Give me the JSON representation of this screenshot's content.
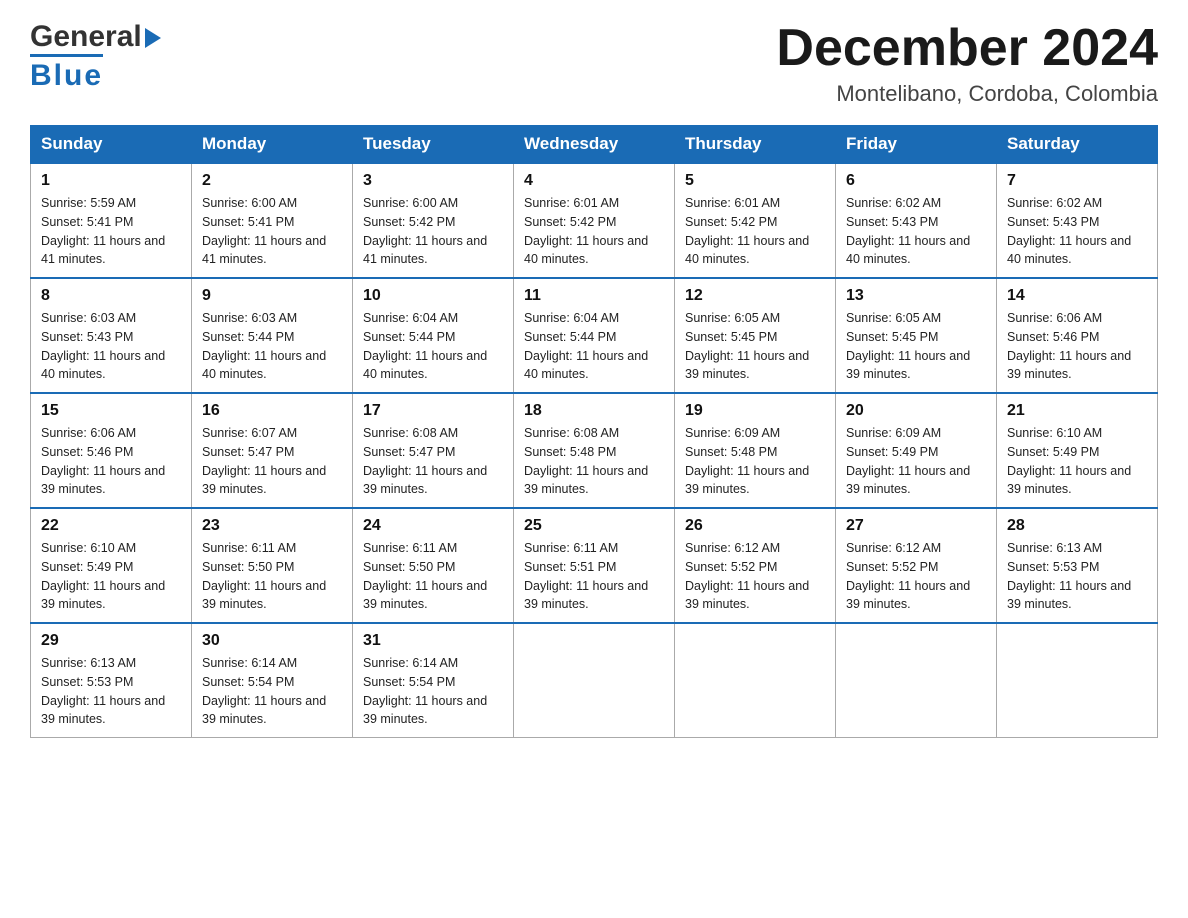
{
  "header": {
    "logo_line1": "General",
    "logo_arrow": "▶",
    "logo_line2": "Blue",
    "month_title": "December 2024",
    "location": "Montelibano, Cordoba, Colombia"
  },
  "days_of_week": [
    "Sunday",
    "Monday",
    "Tuesday",
    "Wednesday",
    "Thursday",
    "Friday",
    "Saturday"
  ],
  "weeks": [
    [
      {
        "day": "1",
        "sunrise": "5:59 AM",
        "sunset": "5:41 PM",
        "daylight": "11 hours and 41 minutes."
      },
      {
        "day": "2",
        "sunrise": "6:00 AM",
        "sunset": "5:41 PM",
        "daylight": "11 hours and 41 minutes."
      },
      {
        "day": "3",
        "sunrise": "6:00 AM",
        "sunset": "5:42 PM",
        "daylight": "11 hours and 41 minutes."
      },
      {
        "day": "4",
        "sunrise": "6:01 AM",
        "sunset": "5:42 PM",
        "daylight": "11 hours and 40 minutes."
      },
      {
        "day": "5",
        "sunrise": "6:01 AM",
        "sunset": "5:42 PM",
        "daylight": "11 hours and 40 minutes."
      },
      {
        "day": "6",
        "sunrise": "6:02 AM",
        "sunset": "5:43 PM",
        "daylight": "11 hours and 40 minutes."
      },
      {
        "day": "7",
        "sunrise": "6:02 AM",
        "sunset": "5:43 PM",
        "daylight": "11 hours and 40 minutes."
      }
    ],
    [
      {
        "day": "8",
        "sunrise": "6:03 AM",
        "sunset": "5:43 PM",
        "daylight": "11 hours and 40 minutes."
      },
      {
        "day": "9",
        "sunrise": "6:03 AM",
        "sunset": "5:44 PM",
        "daylight": "11 hours and 40 minutes."
      },
      {
        "day": "10",
        "sunrise": "6:04 AM",
        "sunset": "5:44 PM",
        "daylight": "11 hours and 40 minutes."
      },
      {
        "day": "11",
        "sunrise": "6:04 AM",
        "sunset": "5:44 PM",
        "daylight": "11 hours and 40 minutes."
      },
      {
        "day": "12",
        "sunrise": "6:05 AM",
        "sunset": "5:45 PM",
        "daylight": "11 hours and 39 minutes."
      },
      {
        "day": "13",
        "sunrise": "6:05 AM",
        "sunset": "5:45 PM",
        "daylight": "11 hours and 39 minutes."
      },
      {
        "day": "14",
        "sunrise": "6:06 AM",
        "sunset": "5:46 PM",
        "daylight": "11 hours and 39 minutes."
      }
    ],
    [
      {
        "day": "15",
        "sunrise": "6:06 AM",
        "sunset": "5:46 PM",
        "daylight": "11 hours and 39 minutes."
      },
      {
        "day": "16",
        "sunrise": "6:07 AM",
        "sunset": "5:47 PM",
        "daylight": "11 hours and 39 minutes."
      },
      {
        "day": "17",
        "sunrise": "6:08 AM",
        "sunset": "5:47 PM",
        "daylight": "11 hours and 39 minutes."
      },
      {
        "day": "18",
        "sunrise": "6:08 AM",
        "sunset": "5:48 PM",
        "daylight": "11 hours and 39 minutes."
      },
      {
        "day": "19",
        "sunrise": "6:09 AM",
        "sunset": "5:48 PM",
        "daylight": "11 hours and 39 minutes."
      },
      {
        "day": "20",
        "sunrise": "6:09 AM",
        "sunset": "5:49 PM",
        "daylight": "11 hours and 39 minutes."
      },
      {
        "day": "21",
        "sunrise": "6:10 AM",
        "sunset": "5:49 PM",
        "daylight": "11 hours and 39 minutes."
      }
    ],
    [
      {
        "day": "22",
        "sunrise": "6:10 AM",
        "sunset": "5:49 PM",
        "daylight": "11 hours and 39 minutes."
      },
      {
        "day": "23",
        "sunrise": "6:11 AM",
        "sunset": "5:50 PM",
        "daylight": "11 hours and 39 minutes."
      },
      {
        "day": "24",
        "sunrise": "6:11 AM",
        "sunset": "5:50 PM",
        "daylight": "11 hours and 39 minutes."
      },
      {
        "day": "25",
        "sunrise": "6:11 AM",
        "sunset": "5:51 PM",
        "daylight": "11 hours and 39 minutes."
      },
      {
        "day": "26",
        "sunrise": "6:12 AM",
        "sunset": "5:52 PM",
        "daylight": "11 hours and 39 minutes."
      },
      {
        "day": "27",
        "sunrise": "6:12 AM",
        "sunset": "5:52 PM",
        "daylight": "11 hours and 39 minutes."
      },
      {
        "day": "28",
        "sunrise": "6:13 AM",
        "sunset": "5:53 PM",
        "daylight": "11 hours and 39 minutes."
      }
    ],
    [
      {
        "day": "29",
        "sunrise": "6:13 AM",
        "sunset": "5:53 PM",
        "daylight": "11 hours and 39 minutes."
      },
      {
        "day": "30",
        "sunrise": "6:14 AM",
        "sunset": "5:54 PM",
        "daylight": "11 hours and 39 minutes."
      },
      {
        "day": "31",
        "sunrise": "6:14 AM",
        "sunset": "5:54 PM",
        "daylight": "11 hours and 39 minutes."
      },
      null,
      null,
      null,
      null
    ]
  ]
}
